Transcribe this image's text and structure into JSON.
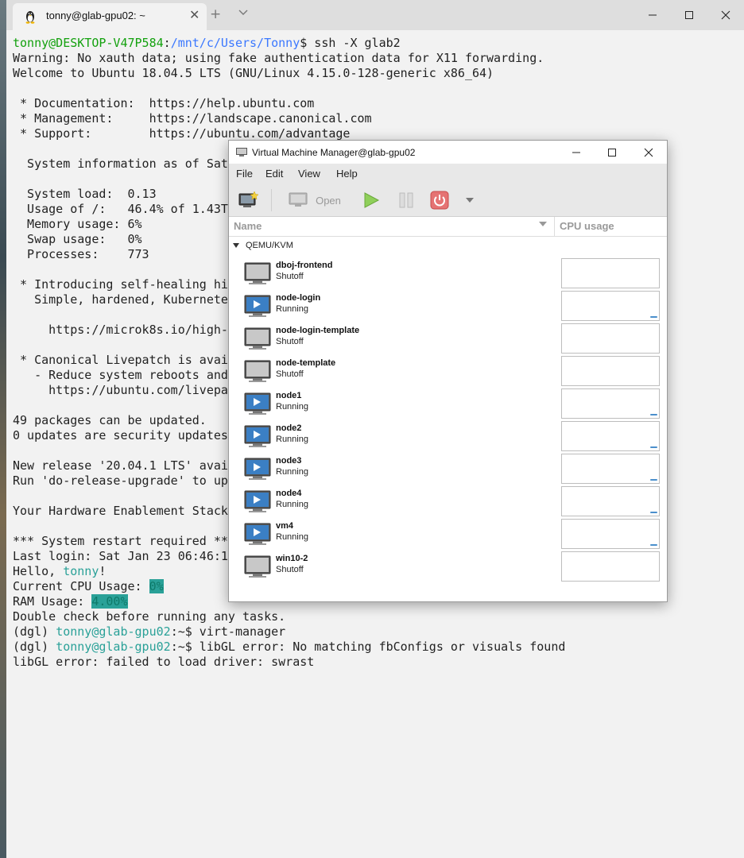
{
  "terminal": {
    "tab_title": "tonny@glab-gpu02: ~",
    "new_tab_glyph": "+",
    "dropdown_glyph": "⌄",
    "lines": [
      [
        [
          "tonny@DESKTOP-V47P584",
          "user"
        ],
        [
          ":",
          ""
        ],
        [
          "/mnt/c/Users/Tonny",
          "path"
        ],
        [
          "$ ssh -X glab2",
          ""
        ]
      ],
      [
        [
          "Warning: No xauth data; using fake authentication data for X11 forwarding.",
          ""
        ]
      ],
      [
        [
          "Welcome to Ubuntu 18.04.5 LTS (GNU/Linux 4.15.0-128-generic x86_64)",
          ""
        ]
      ],
      [],
      [
        [
          " * Documentation:  https://help.ubuntu.com",
          ""
        ]
      ],
      [
        [
          " * Management:     https://landscape.canonical.com",
          ""
        ]
      ],
      [
        [
          " * Support:        https://ubuntu.com/advantage",
          ""
        ]
      ],
      [],
      [
        [
          "  System information as of Sat",
          ""
        ]
      ],
      [],
      [
        [
          "  System load:  0.13",
          ""
        ]
      ],
      [
        [
          "  Usage of /:   46.4% of 1.43T",
          ""
        ]
      ],
      [
        [
          "  Memory usage: 6%",
          ""
        ]
      ],
      [
        [
          "  Swap usage:   0%",
          ""
        ]
      ],
      [
        [
          "  Processes:    773",
          ""
        ]
      ],
      [],
      [
        [
          " * Introducing self-healing hi",
          ""
        ]
      ],
      [
        [
          "   Simple, hardened, Kubernete",
          ""
        ]
      ],
      [],
      [
        [
          "     https://microk8s.io/high-",
          ""
        ]
      ],
      [],
      [
        [
          " * Canonical Livepatch is avai",
          ""
        ]
      ],
      [
        [
          "   - Reduce system reboots and",
          ""
        ]
      ],
      [
        [
          "     https://ubuntu.com/livepa",
          ""
        ]
      ],
      [],
      [
        [
          "49 packages can be updated.",
          ""
        ]
      ],
      [
        [
          "0 updates are security updates",
          ""
        ]
      ],
      [],
      [
        [
          "New release '20.04.1 LTS' avai",
          ""
        ]
      ],
      [
        [
          "Run 'do-release-upgrade' to up",
          ""
        ]
      ],
      [],
      [
        [
          "Your Hardware Enablement Stack",
          ""
        ]
      ],
      [],
      [
        [
          "*** System restart required **",
          ""
        ]
      ],
      [
        [
          "Last login: Sat Jan 23 06:46:1",
          ""
        ]
      ],
      [
        [
          "Hello, ",
          ""
        ],
        [
          "tonny",
          "teal"
        ],
        [
          "!",
          ""
        ]
      ],
      [
        [
          "Current CPU Usage: ",
          ""
        ],
        [
          "0%",
          "hl"
        ]
      ],
      [
        [
          "RAM Usage: ",
          ""
        ],
        [
          "4.00%",
          "hl"
        ]
      ],
      [
        [
          "Double check before running any tasks.",
          ""
        ]
      ],
      [
        [
          "(dgl) ",
          ""
        ],
        [
          "tonny@glab-gpu02",
          "teal"
        ],
        [
          ":~$ virt-manager",
          ""
        ]
      ],
      [
        [
          "(dgl) ",
          ""
        ],
        [
          "tonny@glab-gpu02",
          "teal"
        ],
        [
          ":~$ libGL error: No matching fbConfigs or visuals found",
          ""
        ]
      ],
      [
        [
          "libGL error: failed to load driver: swrast",
          ""
        ]
      ]
    ]
  },
  "vmm": {
    "title": "Virtual Machine Manager@glab-gpu02",
    "menu": [
      "File",
      "Edit",
      "View",
      "Help"
    ],
    "toolbar": {
      "open_label": "Open"
    },
    "columns": {
      "name": "Name",
      "cpu": "CPU usage"
    },
    "group": "QEMU/KVM",
    "vms": [
      {
        "name": "dboj-frontend",
        "status": "Shutoff"
      },
      {
        "name": "node-login",
        "status": "Running"
      },
      {
        "name": "node-login-template",
        "status": "Shutoff"
      },
      {
        "name": "node-template",
        "status": "Shutoff"
      },
      {
        "name": "node1",
        "status": "Running"
      },
      {
        "name": "node2",
        "status": "Running"
      },
      {
        "name": "node3",
        "status": "Running"
      },
      {
        "name": "node4",
        "status": "Running"
      },
      {
        "name": "vm4",
        "status": "Running"
      },
      {
        "name": "win10-2",
        "status": "Shutoff"
      }
    ]
  },
  "colors": {
    "user": "#13a10e",
    "path": "#3b78ff",
    "teal": "#2aa198",
    "power": "#d9534f",
    "play": "#7ac142"
  }
}
